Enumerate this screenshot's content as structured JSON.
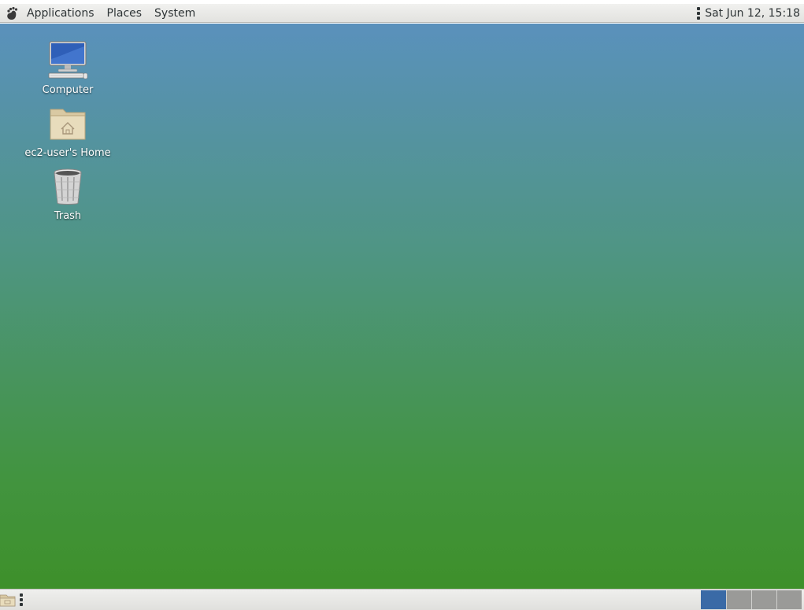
{
  "top_panel": {
    "menus": [
      {
        "label": "Applications"
      },
      {
        "label": "Places"
      },
      {
        "label": "System"
      }
    ],
    "clock": "Sat Jun 12, 15:18"
  },
  "desktop": {
    "icons": [
      {
        "label": "Computer",
        "icon": "computer-icon"
      },
      {
        "label": "ec2-user's Home",
        "icon": "home-folder-icon"
      },
      {
        "label": "Trash",
        "icon": "trash-icon"
      }
    ],
    "colors": {
      "top": "#5a91bc",
      "bottom": "#3e902a"
    }
  },
  "bottom_panel": {
    "workspaces": [
      {
        "active": true
      },
      {
        "active": false
      },
      {
        "active": false
      },
      {
        "active": false
      }
    ],
    "active_color": "#3a6aa6"
  }
}
